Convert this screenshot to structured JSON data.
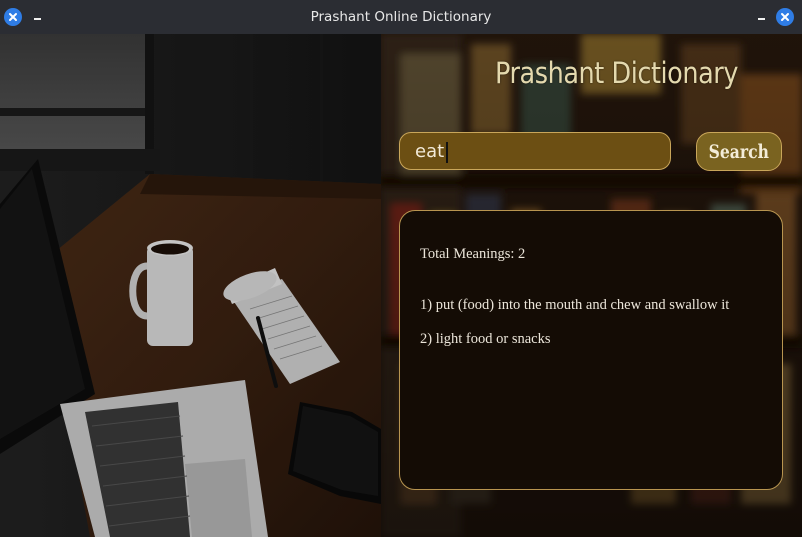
{
  "window": {
    "title": "Prashant Online Dictionary",
    "left_close_icon": "close-icon",
    "left_minimize_icon": "minimize-icon",
    "right_minimize_icon": "minimize-icon",
    "right_close_icon": "close-icon"
  },
  "app": {
    "heading": "Prashant Dictionary"
  },
  "search": {
    "value": "eat",
    "button_label": "Search"
  },
  "results": {
    "total": "Total Meanings: 2",
    "meanings": [
      "1) put (food) into the mouth and chew and swallow it",
      "2) light food or snacks"
    ]
  },
  "colors": {
    "accent_border": "#c9a65a",
    "input_bg": "#6c4f13",
    "button_bg": "#7a6320",
    "titlebar_bg": "#2b2d33",
    "window_button": "#2f7de6"
  }
}
